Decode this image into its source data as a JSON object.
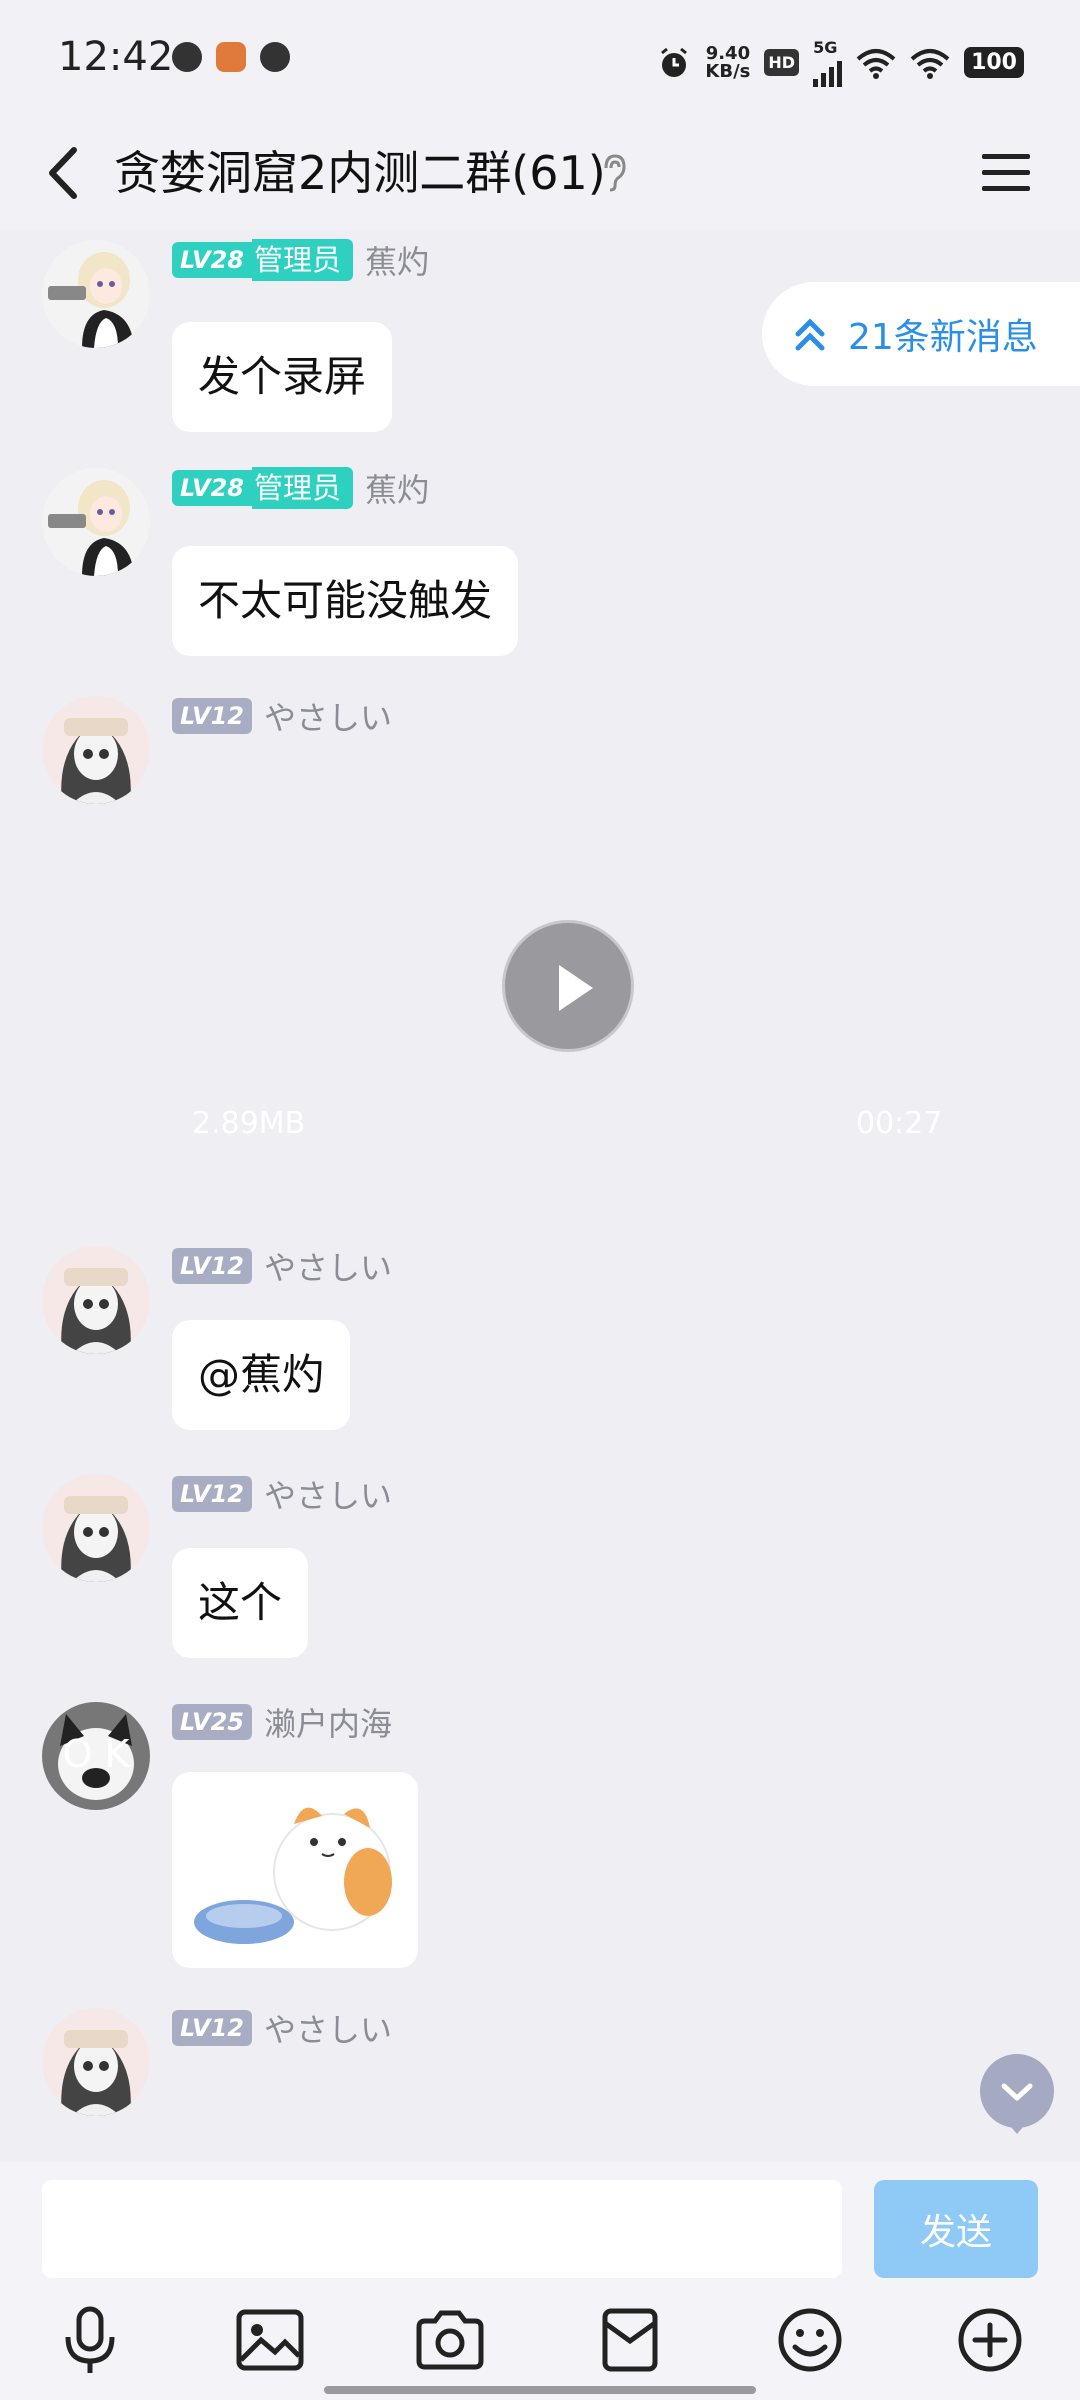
{
  "status_bar": {
    "time": "12:42",
    "net_speed_value": "9.40",
    "net_speed_unit": "KB/s",
    "hd": "HD",
    "signal": "5G",
    "battery": "100",
    "icons": [
      "app-icon-globe",
      "app-icon-cake",
      "app-icon-compass",
      "alarm-icon",
      "signal-icon",
      "wifi-icon",
      "battery-icon"
    ]
  },
  "header": {
    "title": "贪婪洞窟2内测二群(61)",
    "icons": [
      "back-icon",
      "ear-icon",
      "menu-icon"
    ]
  },
  "new_messages": {
    "label": "21条新消息"
  },
  "messages": [
    {
      "level": "LV28",
      "role": "管理员",
      "name": "蕉灼",
      "text": "发个录屏"
    },
    {
      "level": "LV28",
      "role": "管理员",
      "name": "蕉灼",
      "text": "不太可能没触发"
    },
    {
      "level": "LV12",
      "name": "やさしい",
      "video": {
        "size": "2.89MB",
        "duration": "00:27"
      }
    },
    {
      "level": "LV12",
      "name": "やさしい",
      "text": "@蕉灼"
    },
    {
      "level": "LV12",
      "name": "やさしい",
      "text": "这个"
    },
    {
      "level": "LV25",
      "name": "濑户内海",
      "avatar_text": "O K",
      "sticker": "cat-with-bowl-sticker"
    },
    {
      "level": "LV12",
      "name": "やさしい"
    }
  ],
  "input": {
    "placeholder": "",
    "send_label": "发送"
  },
  "toolbar": [
    "microphone-icon",
    "image-icon",
    "camera-icon",
    "red-packet-icon",
    "emoji-icon",
    "plus-icon"
  ],
  "colors": {
    "accent": "#2a8fe8",
    "admin_badge": "#2ed1c0",
    "level_badge": "#a9adc4",
    "send_button": "#8fcaf7",
    "background": "#eeeef3"
  }
}
